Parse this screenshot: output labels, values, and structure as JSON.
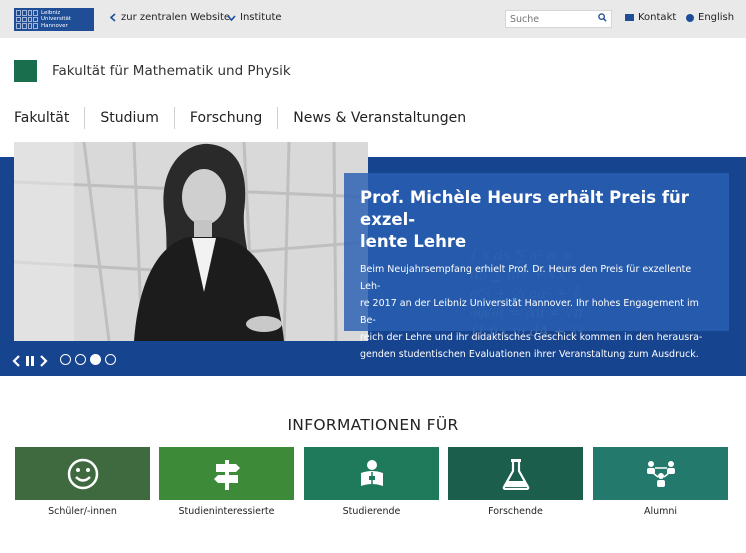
{
  "topbar": {
    "logo_lines": [
      "Leibniz",
      "Universität",
      "Hannover"
    ],
    "back_link": "zur zentralen Website",
    "institutes_link": "Institute",
    "search_placeholder": "Suche",
    "contact_link": "Kontakt",
    "language_link": "English"
  },
  "faculty": {
    "title": "Fakultät für Mathematik und Physik",
    "accent_color": "#196e4e"
  },
  "nav": {
    "items": [
      "Fakultät",
      "Studium",
      "Forschung",
      "News & Veranstaltungen"
    ]
  },
  "hero": {
    "title_line1": "Prof. Michèle Heurs erhält Preis für exzel-",
    "title_line2": "lente Lehre",
    "text_lines": [
      "Beim Neujahrsempfang erhielt Prof. Dr. Heurs den Preis für exzellente Leh-",
      "re 2017 an der Leibniz Universität Hannover. Ihr hohes Engagement im Be-",
      "reich der Lehre und ihr didaktisches Geschick kommen in den herausra-",
      "genden studentischen Evaluationen ihrer Veranstaltung zum Ausdruck."
    ],
    "background_color": "#17448f",
    "slides_total": 4,
    "active_slide": 3
  },
  "info": {
    "heading": "INFORMATIONEN FÜR",
    "tiles": [
      {
        "label": "Schüler/-innen",
        "icon": "smiley-icon",
        "color": "#3f6a3f"
      },
      {
        "label": "Studieninteressierte",
        "icon": "signpost-icon",
        "color": "#3d8a39"
      },
      {
        "label": "Studierende",
        "icon": "student-reading-icon",
        "color": "#1e7a5a"
      },
      {
        "label": "Forschende",
        "icon": "flask-icon",
        "color": "#1b5e4c"
      },
      {
        "label": "Alumni",
        "icon": "network-people-icon",
        "color": "#237a6c"
      }
    ]
  }
}
